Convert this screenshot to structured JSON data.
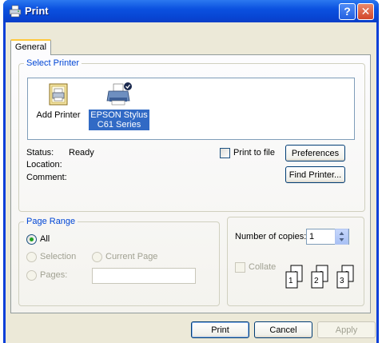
{
  "window": {
    "title": "Print",
    "help_glyph": "?",
    "close_glyph": "✕"
  },
  "tabs": [
    {
      "label": "General"
    }
  ],
  "select_printer": {
    "legend": "Select Printer",
    "printers": [
      {
        "label": "Add Printer",
        "selected": false
      },
      {
        "label_line1": "EPSON Stylus",
        "label_line2": "C61 Series",
        "selected": true
      }
    ],
    "status_label": "Status:",
    "status_value": "Ready",
    "location_label": "Location:",
    "comment_label": "Comment:",
    "print_to_file_label": "Print to file",
    "preferences_button": "Preferences",
    "find_printer_button": "Find Printer..."
  },
  "page_range": {
    "legend": "Page Range",
    "all_label": "All",
    "selection_label": "Selection",
    "current_page_label": "Current Page",
    "pages_label": "Pages:",
    "pages_value": ""
  },
  "copies": {
    "number_label": "Number of copies:",
    "number_value": "1",
    "collate_label": "Collate",
    "collate_pages": [
      "1",
      "1",
      "2",
      "2",
      "3",
      "3"
    ]
  },
  "footer": {
    "print_button": "Print",
    "cancel_button": "Cancel",
    "apply_button": "Apply"
  },
  "colors": {
    "accent": "#0046d5",
    "titlebar": "#0b51e0",
    "selection": "#316ac5"
  }
}
